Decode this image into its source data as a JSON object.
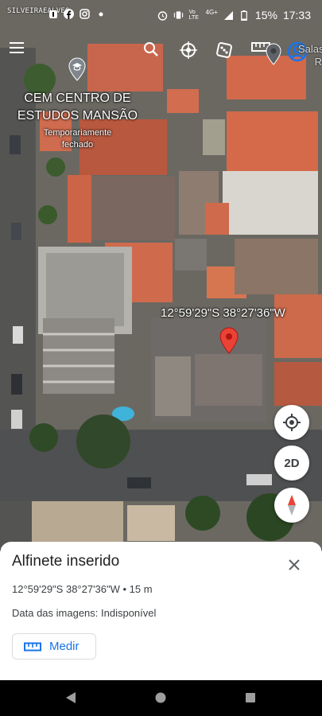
{
  "status_bar": {
    "watermark": "SILVEIRAEALVES",
    "battery": "15%",
    "time": "17:33",
    "network": "4G+",
    "lte": "Vo LTE"
  },
  "map": {
    "poi_name": "CEM CENTRO DE\nESTUDOS MANSÃO",
    "poi_line1": "CEM CENTRO DE",
    "poi_line2": "ESTUDOS MANSÃO",
    "poi_status": "Temporariamente fechado",
    "poi_status_1": "Temporariamente",
    "poi_status_2": "fechado",
    "pin_coords": "12°59'29\"S 38°27'36\"W",
    "corner_label": "Salas",
    "corner_label_2": "R",
    "toolbar_icons": [
      "menu-icon",
      "search-icon",
      "voyager-icon",
      "dice-icon",
      "ruler-icon",
      "place-icon",
      "account-icon"
    ]
  },
  "fabs": {
    "locate": "my-location-icon",
    "mode": "2D",
    "compass": "compass-icon"
  },
  "sheet": {
    "title": "Alfinete inserido",
    "coords": "12°59'29\"S 38°27'36\"W • 15 m",
    "date_label": "Data das imagens: Indisponível",
    "measure_label": "Medir"
  },
  "colors": {
    "accent": "#1a73e8",
    "pin": "#ea4335",
    "roof": "#d9674a"
  }
}
